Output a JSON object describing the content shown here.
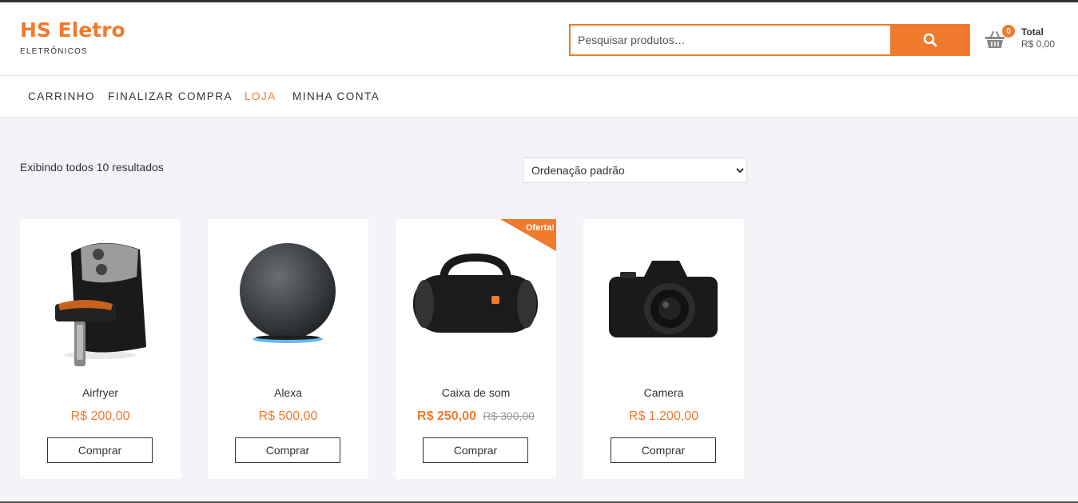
{
  "site": {
    "title": "HS Eletro",
    "tagline": "ELETRÔNICOS"
  },
  "search": {
    "placeholder": "Pesquisar produtos…",
    "icon": "search-icon"
  },
  "cart": {
    "count": "0",
    "total_label": "Total",
    "total_value": "R$ 0,00",
    "icon": "basket-icon"
  },
  "nav": {
    "items": [
      {
        "label": "CARRINHO"
      },
      {
        "label": "FINALIZAR COMPRA"
      },
      {
        "label": "LOJA",
        "active": true
      },
      {
        "label": "MINHA CONTA"
      }
    ]
  },
  "shop": {
    "result_count": "Exibindo todos 10 resultados",
    "ordering": "Ordenação padrão"
  },
  "products": [
    {
      "name": "Airfryer",
      "price": "R$ 200,00",
      "button": "Comprar"
    },
    {
      "name": "Alexa",
      "price": "R$ 500,00",
      "button": "Comprar"
    },
    {
      "name": "Caixa de som",
      "price": "R$ 250,00",
      "old_price": "R$ 300,00",
      "badge": "Oferta!",
      "button": "Comprar"
    },
    {
      "name": "Camera",
      "price": "R$ 1.200,00",
      "button": "Comprar"
    }
  ],
  "colors": {
    "accent": "#f07a2d",
    "background": "#f3f3f8"
  }
}
